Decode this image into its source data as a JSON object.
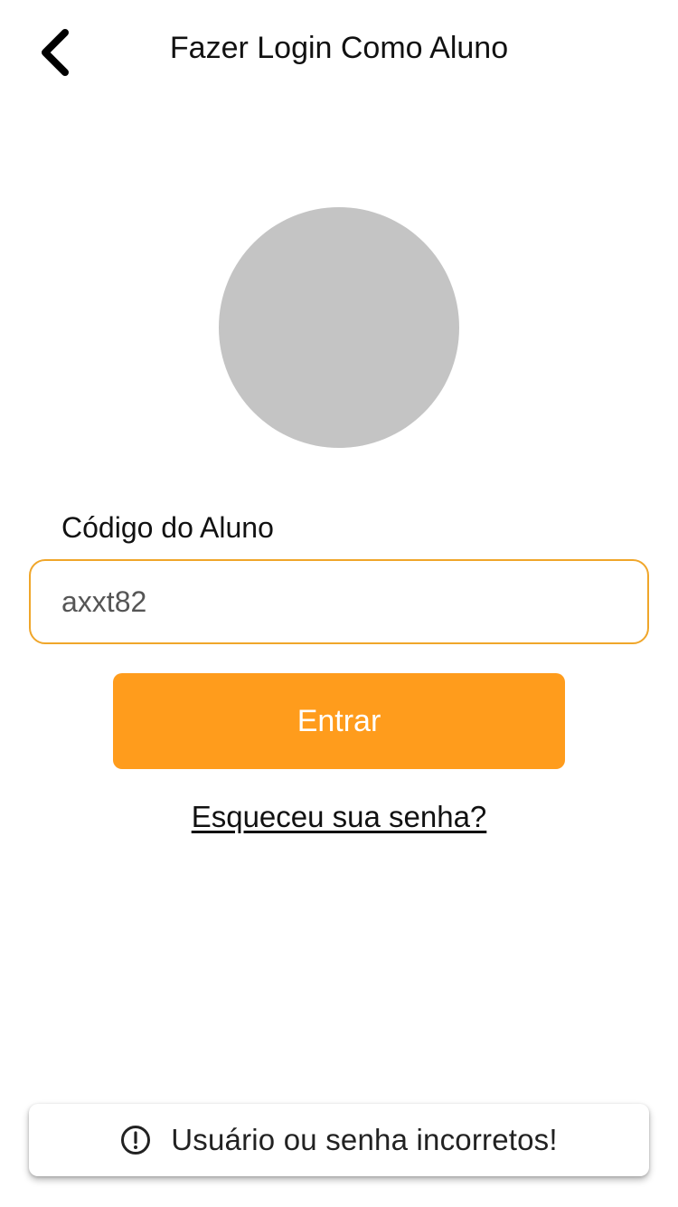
{
  "header": {
    "title": "Fazer Login Como Aluno",
    "back_icon": "chevron-left-icon"
  },
  "avatar": {
    "color": "#c4c4c4"
  },
  "form": {
    "code_label": "Código do Aluno",
    "code_value": "axxt82",
    "code_placeholder": "",
    "submit_label": "Entrar",
    "forgot_label": "Esqueceu sua senha?"
  },
  "toast": {
    "icon": "alert-circle-icon",
    "message": "Usuário ou senha incorretos!"
  },
  "colors": {
    "accent": "#ff9c1c",
    "input_border": "#f0a62a",
    "text": "#111111",
    "background": "#ffffff"
  }
}
